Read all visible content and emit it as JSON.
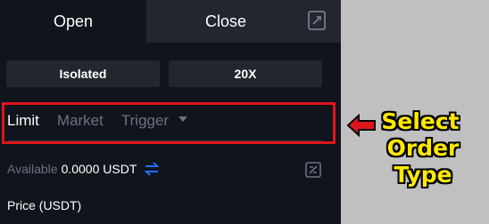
{
  "tabs": {
    "open_label": "Open",
    "close_label": "Close"
  },
  "buttons": {
    "margin_mode": "Isolated",
    "leverage": "20X"
  },
  "order_types": [
    {
      "label": "Limit",
      "active": true
    },
    {
      "label": "Market",
      "active": false
    },
    {
      "label": "Trigger",
      "active": false
    }
  ],
  "available": {
    "label": "Available",
    "value": "0.0000 USDT"
  },
  "price": {
    "label": "Price (USDT)"
  },
  "annotation": {
    "line1": "Select",
    "line2": "Order Type"
  },
  "colors": {
    "accent": "#1e6fff",
    "highlight": "#e0151b",
    "callout_text": "#ffe800",
    "panel_bg": "#10141c"
  },
  "icons": [
    "calculator-icon",
    "swap-icon",
    "calculator-small-icon",
    "arrow-left-icon",
    "chevron-down-icon"
  ]
}
